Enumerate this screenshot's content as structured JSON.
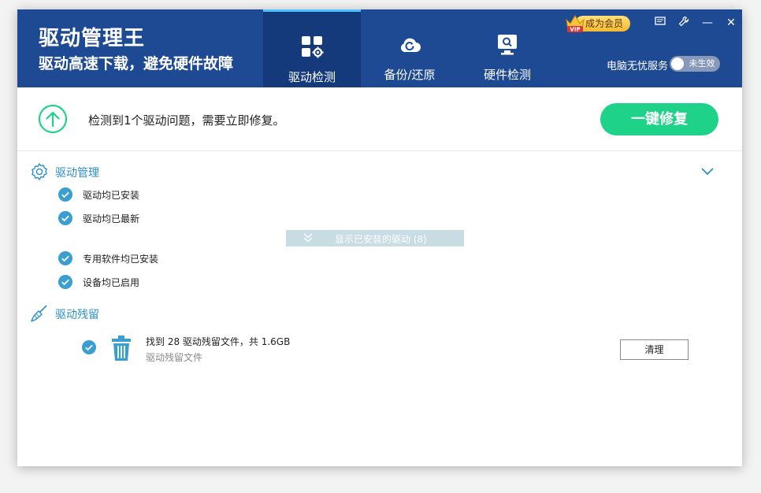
{
  "header": {
    "title": "驱动管理王",
    "subtitle": "驱动高速下载，避免硬件故障",
    "tabs": [
      {
        "label": "驱动检测",
        "icon": "driver-scan-icon",
        "active": true
      },
      {
        "label": "备份/还原",
        "icon": "backup-restore-icon",
        "active": false
      },
      {
        "label": "硬件检测",
        "icon": "hardware-check-icon",
        "active": false
      }
    ],
    "vip_label": "成为会员",
    "vip_badge_text": "VIP",
    "service_label": "电脑无忧服务",
    "service_toggle_text": "未生效",
    "controls": {
      "menu_icon": "message-icon",
      "skin_icon": "wrench-icon",
      "minimize_glyph": "—",
      "close_glyph": "✕"
    }
  },
  "alert": {
    "message": "检测到1个驱动问题，需要立即修复。",
    "repair_button": "一键修复"
  },
  "driver_section": {
    "title": "驱动管理",
    "items": [
      {
        "label": "驱动均已安装"
      },
      {
        "label": "驱动均已最新"
      },
      {
        "label": "专用软件均已安装"
      },
      {
        "label": "设备均已启用"
      }
    ],
    "show_installed": "显示已安装的驱动 (8)"
  },
  "residue_section": {
    "title": "驱动残留",
    "title_line": "找到 28 驱动残留文件，共 1.6GB",
    "description": "驱动残留文件",
    "clean_button": "清理"
  },
  "colors": {
    "header_bg": "#1e4a94",
    "active_tab_bg": "#153a7c",
    "accent_blue": "#2a8fc9",
    "repair_green": "#1ed389",
    "check_blue": "#3a9fd0",
    "vip_gold": "#f5b92e"
  }
}
